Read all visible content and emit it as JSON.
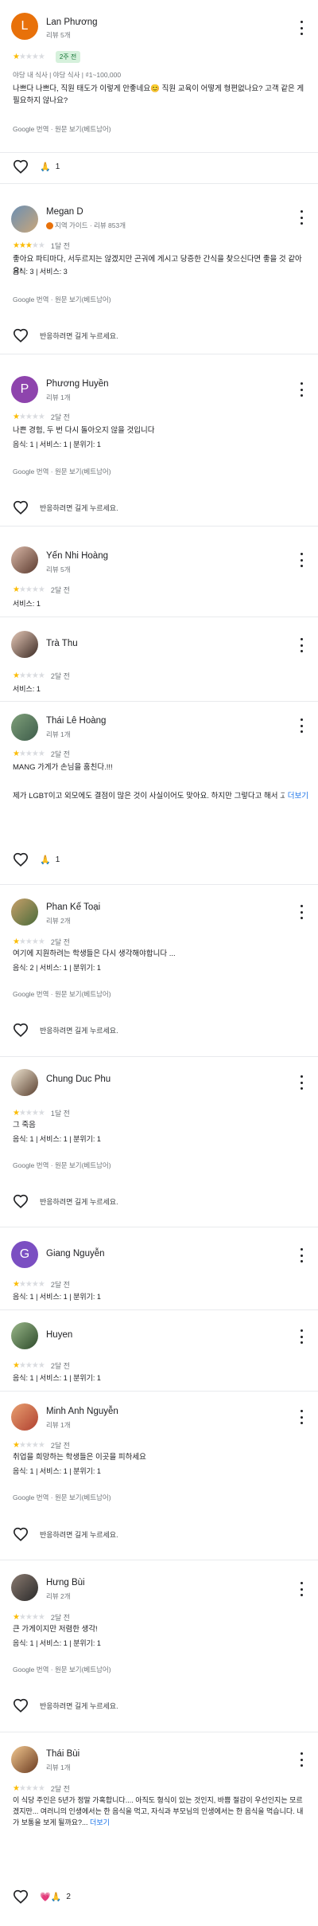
{
  "translate_label": "Google 번역 · 원문 보기(베트남어)",
  "like_prompt": "반응하려면 길게 누르세요.",
  "colors": {
    "star": "#fbbc04",
    "badge_bg": "#d6f1dc",
    "badge_text": "#137333",
    "link": "#1a73e8"
  },
  "reviews": [
    {
      "name": "Lan Phương",
      "initial": "L",
      "avatar_color": "#e8710a",
      "meta": "리뷰 5개",
      "rating": 1,
      "time": "",
      "badge": "2주 전",
      "meta_line": "야당 내 식사  |  야당 식사  |  ₫1~100,000",
      "text": "나쁘다 나쁘다, 직원 태도가 이렇게 안좋네요😊 직원 교육이 어떻게 형편없나요? 고객 같은 게 필요하지 않나요?",
      "reaction": "🙏",
      "reaction_count": "1"
    },
    {
      "name": "Megan D",
      "meta": "지역 가이드 · 리뷰 853개",
      "rating": 3,
      "time": "1달 전",
      "text": "좋아요 파티마다, 서두르지는 않겠지만 곤궈에 게시고 당증한 간식을 찾으신다면 좋을 것 같아요!",
      "detail": "음식: 3 | 서비스: 3"
    },
    {
      "name": "Phương Huyền",
      "initial": "P",
      "avatar_color": "#8e44ad",
      "meta": "리뷰 1개",
      "rating": 1,
      "time": "2달 전",
      "text": "나쁜 경험, 두 번 다시 돌아오지 않을 것입니다",
      "detail": "음식: 1 | 서비스: 1 | 분위기: 1"
    },
    {
      "name": "Yến Nhi Hoàng",
      "meta": "리뷰 5개",
      "rating": 1,
      "time": "2달 전",
      "detail": "서비스: 1"
    },
    {
      "name": "Trà Thu",
      "meta": "",
      "rating": 1,
      "time": "2달 전",
      "detail": "서비스: 1"
    },
    {
      "name": "Thái Lê Hoàng",
      "meta": "리뷰 1개",
      "rating": 1,
      "time": "2달 전",
      "text": "MANG 가게가 손님을 훔친다.!!!",
      "text2": "제가 LGBT이고 외모에도 결점이 많은 것이 사실이어도 맞아요. 하지만 그렇다고 해서 고...",
      "more": "더보기",
      "reaction": "🙏",
      "reaction_count": "1"
    },
    {
      "name": "Phan Kế Toại",
      "meta": "리뷰 2개",
      "rating": 1,
      "time": "2달 전",
      "text": "여기에 지원하려는 학생들은 다시 생각해야합니다 ...",
      "detail": "음식: 2 | 서비스: 1 | 분위기: 1"
    },
    {
      "name": "Chung Duc Phu",
      "meta": "",
      "rating": 1,
      "time": "1달 전",
      "text": "그 죽음",
      "detail": "음식: 1 | 서비스: 1 | 분위기: 1"
    },
    {
      "name": "Giang Nguyễn",
      "initial": "G",
      "avatar_color": "#7b4fc2",
      "meta": "",
      "rating": 1,
      "time": "2달 전",
      "detail": "음식: 1 | 서비스: 1 | 분위기: 1"
    },
    {
      "name": "Huyen",
      "meta": "",
      "rating": 1,
      "time": "2달 전",
      "detail": "음식: 1 | 서비스: 1 | 분위기: 1"
    },
    {
      "name": "Minh Anh Nguyễn",
      "meta": "리뷰 1개",
      "rating": 1,
      "time": "2달 전",
      "text": "취업을 희망하는 학생들은 이곳을 피하세요",
      "detail": "음식: 1 | 서비스: 1 | 분위기: 1"
    },
    {
      "name": "Hưng Bùi",
      "meta": "리뷰 2개",
      "rating": 1,
      "time": "2달 전",
      "text": "큰 가게이지만 저렴한 생각!",
      "detail": "음식: 1 | 서비스: 1 | 분위기: 1"
    },
    {
      "name": "Thái Bùi",
      "meta": "리뷰 1개",
      "rating": 1,
      "time": "2달 전",
      "text": "이 식당 주인은 5년가 정말 가혹합니다.... 아직도 형식이 있는 것인지, 바쁨 절감이 우선인지는 모르겠지만... 여러니의 인생에서는 한 음식을 먹고, 자식과 부모님의 인생에서는 한 음식을 먹습니다. 내가 보통을 보게 될까요?...",
      "more": "더보기",
      "reaction": "💗🙏",
      "reaction_count": "2"
    }
  ]
}
